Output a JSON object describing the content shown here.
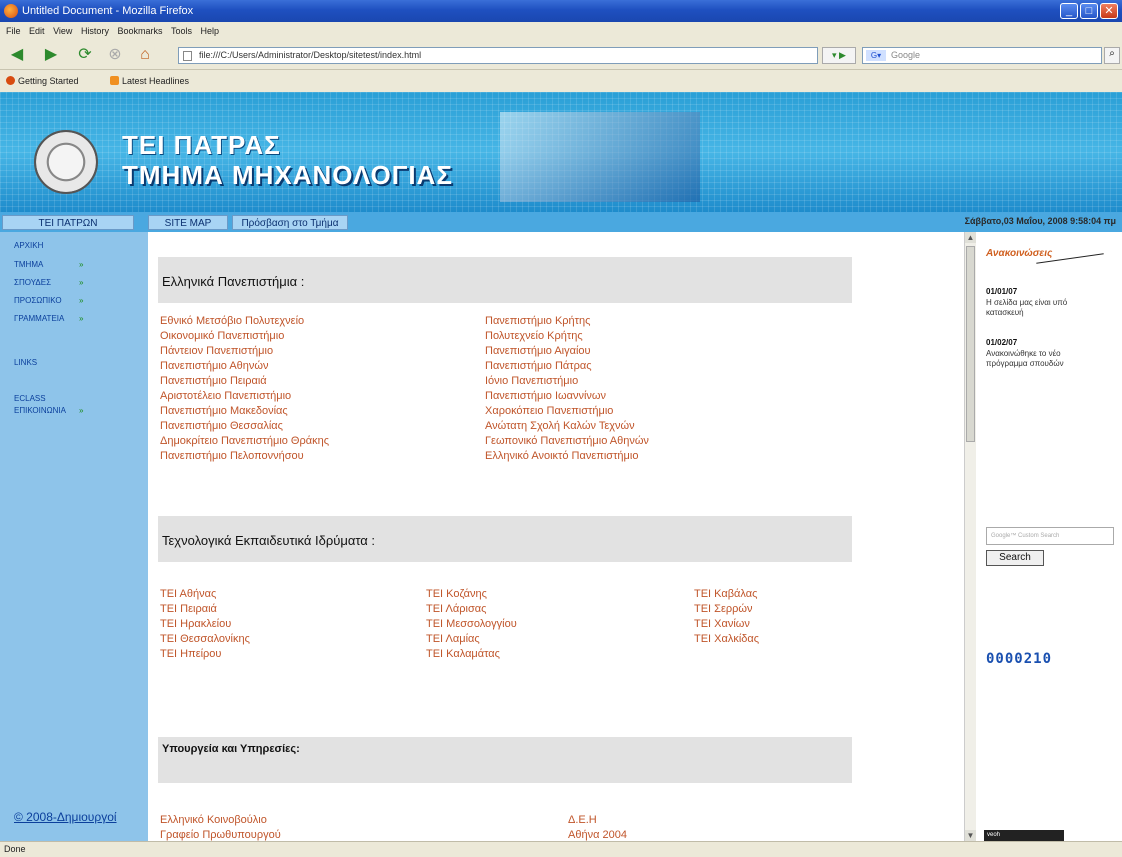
{
  "window": {
    "title": "Untitled Document - Mozilla Firefox"
  },
  "menubar": [
    "File",
    "Edit",
    "View",
    "History",
    "Bookmarks",
    "Tools",
    "Help"
  ],
  "navigation": {
    "url": "file:///C:/Users/Administrator/Desktop/sitetest/index.html",
    "search_placeholder": "Google"
  },
  "bookmarks": [
    "Getting Started",
    "Latest Headlines"
  ],
  "banner": {
    "title1": "ΤΕΙ ΠΑΤΡΑΣ",
    "title2": "ΤΜΗΜΑ ΜΗΧΑΝΟΛΟΓΙΑΣ"
  },
  "topnav": {
    "items": [
      "ΤΕΙ ΠΑΤΡΩΝ",
      "SITE MAP",
      "Πρόσβαση στο Τμήμα"
    ],
    "datetime": "Σάββατο,03 Μαΐου, 2008 9:58:04 πμ"
  },
  "sidebar": {
    "items": [
      "ΑΡΧΙΚΗ",
      "ΤΜΗΜΑ",
      "ΣΠΟΥΔΕΣ",
      "ΠΡΟΣΩΠΙΚΟ",
      "ΓΡΑΜΜΑΤΕΙΑ",
      "LINKS",
      "ECLASS",
      "ΕΠΙΚΟΙΝΩΝΙΑ"
    ],
    "copyright": "© 2008-Δημιουργοί"
  },
  "sections": {
    "universities_title": "Ελληνικά Πανεπιστήμια :",
    "universities_col1": [
      "Εθνικό Μετσόβιο Πολυτεχνείο",
      "Οικονομικό Πανεπιστήμιο",
      "Πάντειον Πανεπιστήμιο",
      "Πανεπιστήμιο Αθηνών",
      "Πανεπιστήμιο Πειραιά",
      "Αριστοτέλειο Πανεπιστήμιο",
      "Πανεπιστήμιο Μακεδονίας",
      "Πανεπιστήμιο Θεσσαλίας",
      "Δημοκρίτειο Πανεπιστήμιο Θράκης",
      "Πανεπιστήμιο Πελοποννήσου"
    ],
    "universities_col2": [
      "Πανεπιστήμιο Κρήτης",
      "Πολυτεχνείο Κρήτης",
      "Πανεπιστήμιο Αιγαίου",
      "Πανεπιστήμιο Πάτρας",
      "Ιόνιο Πανεπιστήμιο",
      "Πανεπιστήμιο Ιωαννίνων",
      "Χαροκόπειο Πανεπιστήμιο",
      "Ανώτατη Σχολή Καλών Τεχνών",
      "Γεωπονικό Πανεπιστήμιο Αθηνών",
      "Ελληνικό Ανοικτό Πανεπιστήμιο"
    ],
    "tei_title": "Τεχνολογικά Εκπαιδευτικά Ιδρύματα :",
    "tei_col1": [
      "ΤΕΙ Αθήνας",
      "ΤΕΙ Πειραιά",
      "ΤΕΙ Ηρακλείου",
      "ΤΕΙ Θεσσαλονίκης",
      "ΤΕΙ Ηπείρου"
    ],
    "tei_col2": [
      "ΤΕΙ Κοζάνης",
      "ΤΕΙ Λάρισας",
      "ΤΕΙ Μεσσολογγίου",
      "ΤΕΙ Λαμίας",
      "ΤΕΙ Καλαμάτας"
    ],
    "tei_col3": [
      "ΤΕΙ Καβάλας",
      "ΤΕΙ Σερρών",
      "ΤΕΙ Χανίων",
      "ΤΕΙ Χαλκίδας"
    ],
    "ministries_title": "Υπουργεία και Υπηρεσίες:",
    "ministries_col1": [
      "Ελληνικό Κοινοβούλιο",
      "Γραφείο Πρωθυπουργού"
    ],
    "ministries_col2": [
      "Δ.Ε.Η",
      "Αθήνα 2004"
    ]
  },
  "news": {
    "title": "Ανακοινώσεις",
    "items": [
      {
        "date": "01/01/07",
        "text": "Η σελίδα μας είναι υπό κατασκευή"
      },
      {
        "date": "01/02/07",
        "text": "Ανακοινώθηκε το νέο πρόγραμμα σπουδών"
      }
    ]
  },
  "gsearch": {
    "placeholder": "Google™ Custom Search",
    "button": "Search"
  },
  "counter": "0000210",
  "widget": "veoh",
  "status": "Done"
}
